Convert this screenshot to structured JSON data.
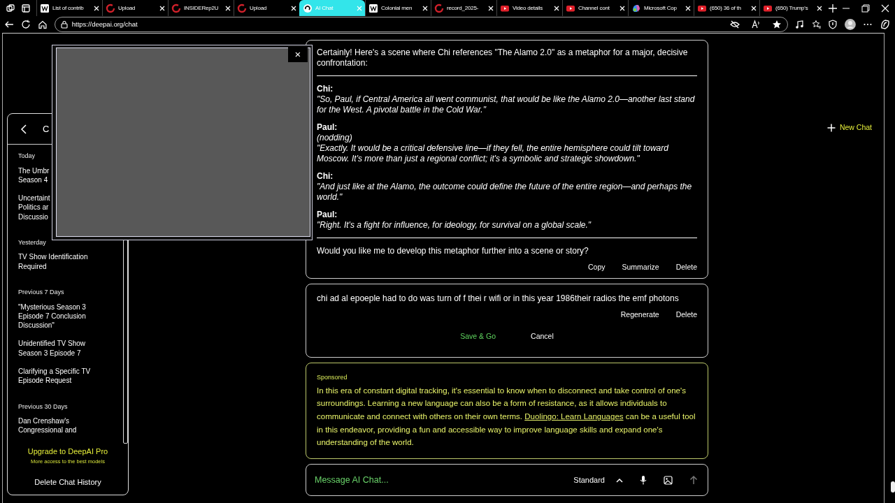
{
  "browser": {
    "tabs": [
      {
        "label": "List of contrib",
        "kind": "wiki",
        "selected": false
      },
      {
        "label": "Upload",
        "kind": "ring",
        "selected": false
      },
      {
        "label": "INSIDERep2U",
        "kind": "ring",
        "selected": false
      },
      {
        "label": "Upload",
        "kind": "ring",
        "selected": false
      },
      {
        "label": "AI Chat",
        "kind": "swirl",
        "selected": true
      },
      {
        "label": "Colonial men",
        "kind": "wiki",
        "selected": false
      },
      {
        "label": "record_2025-",
        "kind": "ring",
        "selected": false
      },
      {
        "label": "Video details",
        "kind": "video",
        "selected": false
      },
      {
        "label": "Channel cont",
        "kind": "video",
        "selected": false
      },
      {
        "label": "Microsoft Cop",
        "kind": "copilot",
        "selected": false
      },
      {
        "label": "(650) 36 of th",
        "kind": "video",
        "selected": false
      },
      {
        "label": "(650) Trump's",
        "kind": "video",
        "selected": false
      }
    ],
    "url": "https://deepai.org/chat"
  },
  "popup": {
    "close": "×"
  },
  "sidebar": {
    "title": "C",
    "groups": [
      {
        "heading": "Today",
        "items": [
          {
            "lines": [
              "The Umbr",
              "Season 4"
            ]
          },
          {
            "lines": [
              "Uncertaint",
              "Politics ar",
              "Discussio"
            ]
          }
        ]
      },
      {
        "heading": "Yesterday",
        "items": [
          {
            "lines": [
              "TV Show Identification",
              "Required"
            ]
          }
        ]
      },
      {
        "heading": "Previous 7 Days",
        "items": [
          {
            "lines": [
              "\"Mysterious Season 3",
              "Episode 7 Conclusion",
              "Discussion\""
            ]
          },
          {
            "lines": [
              "Unidentified TV Show",
              "Season 3 Episode 7"
            ]
          },
          {
            "lines": [
              "Clarifying a Specific TV",
              "Episode Request"
            ]
          }
        ]
      },
      {
        "heading": "Previous 30 Days",
        "items": [
          {
            "lines": [
              "Dan Crenshaw's",
              "Congressional and"
            ]
          }
        ]
      }
    ],
    "upgrade": {
      "title": "Upgrade to DeepAI Pro",
      "subtitle": "More access to the best models"
    },
    "delete_history": "Delete Chat History"
  },
  "new_chat": "New Chat",
  "reply": {
    "intro": "Certainly! Here's a scene where Chi references \"The Alamo 2.0\" as a metaphor for a major, decisive confrontation:",
    "dialogue": [
      {
        "speaker": "Chi:",
        "lines": [
          "\"So, Paul, if Central America all went communist, that would be like the Alamo 2.0—another last stand for the West. A pivotal battle in the Cold War.\""
        ]
      },
      {
        "speaker": "Paul:",
        "lines": [
          "(nodding)",
          "\"Exactly. It would be a critical defensive line—if they fell, the entire hemisphere could tilt toward Moscow. It's more than just a regional conflict; it's a symbolic and strategic showdown.\""
        ]
      },
      {
        "speaker": "Chi:",
        "lines": [
          "\"And just like at the Alamo, the outcome could define the future of the entire region—and perhaps the world.\""
        ]
      },
      {
        "speaker": "Paul:",
        "lines": [
          "\"Right. It's a fight for influence, for ideology, for survival on a global scale.\""
        ]
      }
    ],
    "closing": "Would you like me to develop this metaphor further into a scene or story?",
    "actions": [
      "Copy",
      "Summarize",
      "Delete"
    ]
  },
  "edit": {
    "value": "chi ad al epoeple had to do was turn of f thei r wifi or in this year 1986their radios the emf photons",
    "actions": [
      "Regenerate",
      "Delete"
    ],
    "save": "Save & Go",
    "cancel": "Cancel"
  },
  "sponsored": {
    "label": "Sponsored",
    "before": "In this era of constant digital tracking, it's essential to know when to disconnect and take control of one's surroundings. Learning a new language can also be a form of resistance, as it allows individuals to communicate and connect with others on their own terms. ",
    "link": "Duolingo: Learn Languages",
    "after": " can be a useful tool in this endeavor, providing a fun and accessible way to improve language skills and expand one's understanding of the world."
  },
  "composer": {
    "placeholder": "Message AI Chat...",
    "model": "Standard"
  }
}
